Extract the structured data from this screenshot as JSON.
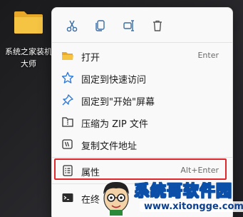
{
  "desktop": {
    "folder_label_line1": "系统之家装机",
    "folder_label_line2": "大师"
  },
  "quick_actions": [
    {
      "name": "cut",
      "icon": "scissors-icon"
    },
    {
      "name": "copy",
      "icon": "copy-icon"
    },
    {
      "name": "rename",
      "icon": "rename-icon"
    },
    {
      "name": "delete",
      "icon": "trash-icon"
    }
  ],
  "menu": {
    "items": [
      {
        "label": "打开",
        "shortcut": "Enter",
        "icon": "folder-open-icon"
      },
      {
        "label": "固定到快速访问",
        "shortcut": "",
        "icon": "star-icon"
      },
      {
        "label": "固定到\"开始\"屏幕",
        "shortcut": "",
        "icon": "pin-icon"
      },
      {
        "label": "压缩为 ZIP 文件",
        "shortcut": "",
        "icon": "zip-folder-icon"
      },
      {
        "label": "复制文件地址",
        "shortcut": "",
        "icon": "copy-path-icon"
      },
      {
        "label": "属性",
        "shortcut": "Alt+Enter",
        "icon": "properties-icon"
      },
      {
        "label": "在终",
        "shortcut": "",
        "icon": "terminal-icon"
      }
    ]
  },
  "watermark": {
    "title": "系统哥软件园",
    "url": "www.xitongge.com"
  },
  "colors": {
    "highlight_border": "#e0282c",
    "menu_background": "#f9f9f9",
    "folder_yellow": "#f6c443"
  }
}
